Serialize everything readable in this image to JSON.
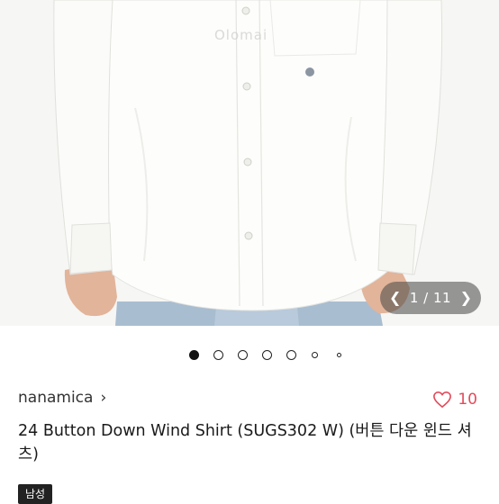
{
  "gallery": {
    "watermark": "Olomai",
    "current_page": 1,
    "total_pages": 11,
    "counter_text": "1 / 11",
    "prev_icon": "chevron-left-icon",
    "next_icon": "chevron-right-icon",
    "dots": {
      "count": 7,
      "active_index": 0
    }
  },
  "product": {
    "brand": "nanamica",
    "like_count": "10",
    "title": "24   Button Down Wind Shirt (SUGS302 W) (버튼 다운 윈드 셔츠)",
    "badge": "남성"
  },
  "colors": {
    "like": "#e24b5b",
    "badge_bg": "#222222"
  }
}
